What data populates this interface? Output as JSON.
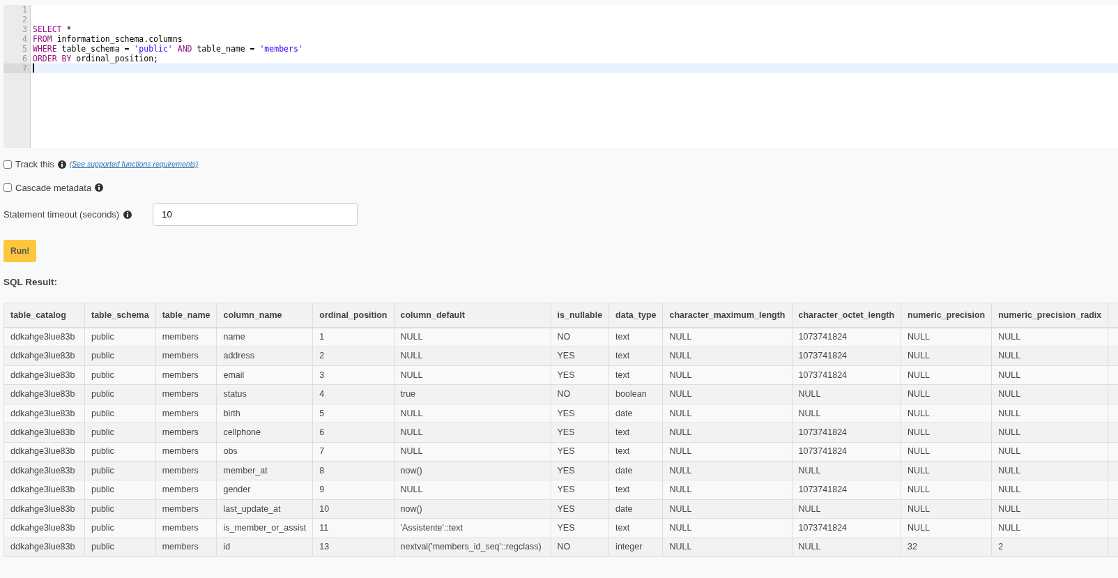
{
  "editor": {
    "lines": [
      {
        "number": "1",
        "active": false
      },
      {
        "number": "2",
        "active": false
      },
      {
        "number": "3",
        "active": false,
        "tokens": [
          {
            "text": "SELECT",
            "kind": "keyword"
          },
          {
            "text": " *",
            "kind": "plain"
          }
        ]
      },
      {
        "number": "4",
        "active": false,
        "tokens": [
          {
            "text": "FROM",
            "kind": "keyword"
          },
          {
            "text": " information_schema.columns",
            "kind": "plain"
          }
        ]
      },
      {
        "number": "5",
        "active": false,
        "tokens": [
          {
            "text": "WHERE",
            "kind": "keyword"
          },
          {
            "text": " table_schema = ",
            "kind": "plain"
          },
          {
            "text": "'public'",
            "kind": "string"
          },
          {
            "text": " AND",
            "kind": "keyword"
          },
          {
            "text": " table_name = ",
            "kind": "plain"
          },
          {
            "text": "'members'",
            "kind": "string"
          }
        ]
      },
      {
        "number": "6",
        "active": false,
        "tokens": [
          {
            "text": "ORDER BY",
            "kind": "keyword"
          },
          {
            "text": " ordinal_position;",
            "kind": "plain"
          }
        ]
      },
      {
        "number": "7",
        "active": true
      }
    ]
  },
  "options": [
    {
      "label": "Track this",
      "checked": false,
      "link": "(See supported functions requirements)"
    },
    {
      "label": "Cascade metadata",
      "checked": false
    }
  ],
  "timeout": {
    "label": "Statement timeout (seconds)",
    "value": "10"
  },
  "run_button": "Run!",
  "result": {
    "title": "SQL Result:",
    "columns": [
      "table_catalog",
      "table_schema",
      "table_name",
      "column_name",
      "ordinal_position",
      "column_default",
      "is_nullable",
      "data_type",
      "character_maximum_length",
      "character_octet_length",
      "numeric_precision",
      "numeric_precision_radix"
    ],
    "rows": [
      [
        "ddkahge3lue83b",
        "public",
        "members",
        "name",
        "1",
        "NULL",
        "NO",
        "text",
        "NULL",
        "1073741824",
        "NULL",
        "NULL"
      ],
      [
        "ddkahge3lue83b",
        "public",
        "members",
        "address",
        "2",
        "NULL",
        "YES",
        "text",
        "NULL",
        "1073741824",
        "NULL",
        "NULL"
      ],
      [
        "ddkahge3lue83b",
        "public",
        "members",
        "email",
        "3",
        "NULL",
        "YES",
        "text",
        "NULL",
        "1073741824",
        "NULL",
        "NULL"
      ],
      [
        "ddkahge3lue83b",
        "public",
        "members",
        "status",
        "4",
        "true",
        "NO",
        "boolean",
        "NULL",
        "NULL",
        "NULL",
        "NULL"
      ],
      [
        "ddkahge3lue83b",
        "public",
        "members",
        "birth",
        "5",
        "NULL",
        "YES",
        "date",
        "NULL",
        "NULL",
        "NULL",
        "NULL"
      ],
      [
        "ddkahge3lue83b",
        "public",
        "members",
        "cellphone",
        "6",
        "NULL",
        "YES",
        "text",
        "NULL",
        "1073741824",
        "NULL",
        "NULL"
      ],
      [
        "ddkahge3lue83b",
        "public",
        "members",
        "obs",
        "7",
        "NULL",
        "YES",
        "text",
        "NULL",
        "1073741824",
        "NULL",
        "NULL"
      ],
      [
        "ddkahge3lue83b",
        "public",
        "members",
        "member_at",
        "8",
        "now()",
        "YES",
        "date",
        "NULL",
        "NULL",
        "NULL",
        "NULL"
      ],
      [
        "ddkahge3lue83b",
        "public",
        "members",
        "gender",
        "9",
        "NULL",
        "YES",
        "text",
        "NULL",
        "1073741824",
        "NULL",
        "NULL"
      ],
      [
        "ddkahge3lue83b",
        "public",
        "members",
        "last_update_at",
        "10",
        "now()",
        "YES",
        "date",
        "NULL",
        "NULL",
        "NULL",
        "NULL"
      ],
      [
        "ddkahge3lue83b",
        "public",
        "members",
        "is_member_or_assist",
        "11",
        "'Assistente'::text",
        "YES",
        "text",
        "NULL",
        "1073741824",
        "NULL",
        "NULL"
      ],
      [
        "ddkahge3lue83b",
        "public",
        "members",
        "id",
        "13",
        "nextval('members_id_seq'::regclass)",
        "NO",
        "integer",
        "NULL",
        "NULL",
        "32",
        "2"
      ]
    ]
  }
}
